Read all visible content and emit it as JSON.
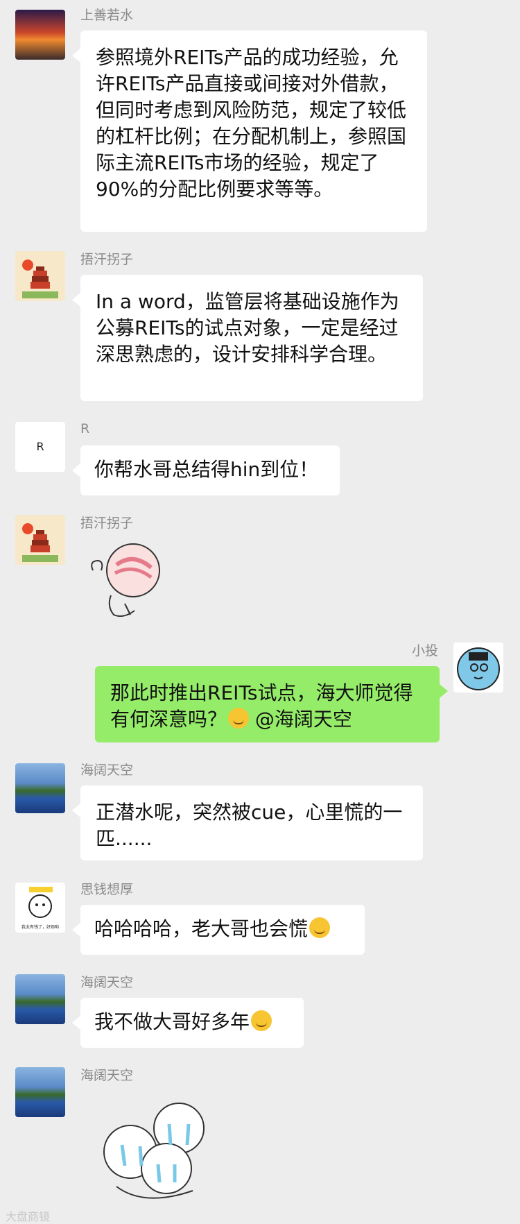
{
  "messages": [
    {
      "sender": "上善若水",
      "text": "参照境外REITs产品的成功经验，允许REITs产品直接或间接对外借款，但同时考虑到风险防范，规定了较低的杠杆比例；在分配机制上，参照国际主流REITs市场的经验，规定了90%的分配比例要求等等。"
    },
    {
      "sender": "捂汗拐子",
      "text": "In a word，监管层将基础设施作为公募REITs的试点对象，一定是经过深思熟虑的，设计安排科学合理。"
    },
    {
      "sender": "R",
      "text": "你帮水哥总结得hin到位！",
      "avatar_letter": "R"
    },
    {
      "sender": "捂汗拐子",
      "sticker": "peach-hug-sticker"
    },
    {
      "sender": "小投",
      "text": "那此时推出REITs试点，海大师觉得有何深意吗？",
      "mention": "@海阔天空"
    },
    {
      "sender": "海阔天空",
      "text": "正潜水呢，突然被cue，心里慌的一匹......"
    },
    {
      "sender": "思钱想厚",
      "text": "哈哈哈哈，老大哥也会慌",
      "avatar_caption": "我太有钱了，好烦哟"
    },
    {
      "sender": "海阔天空",
      "text": "我不做大哥好多年"
    },
    {
      "sender": "海阔天空",
      "sticker": "crying-hug-sticker"
    }
  ],
  "watermark": "大盘商镜",
  "colors": {
    "background": "#ededed",
    "bubble_left": "#ffffff",
    "bubble_right": "#95ec69"
  }
}
